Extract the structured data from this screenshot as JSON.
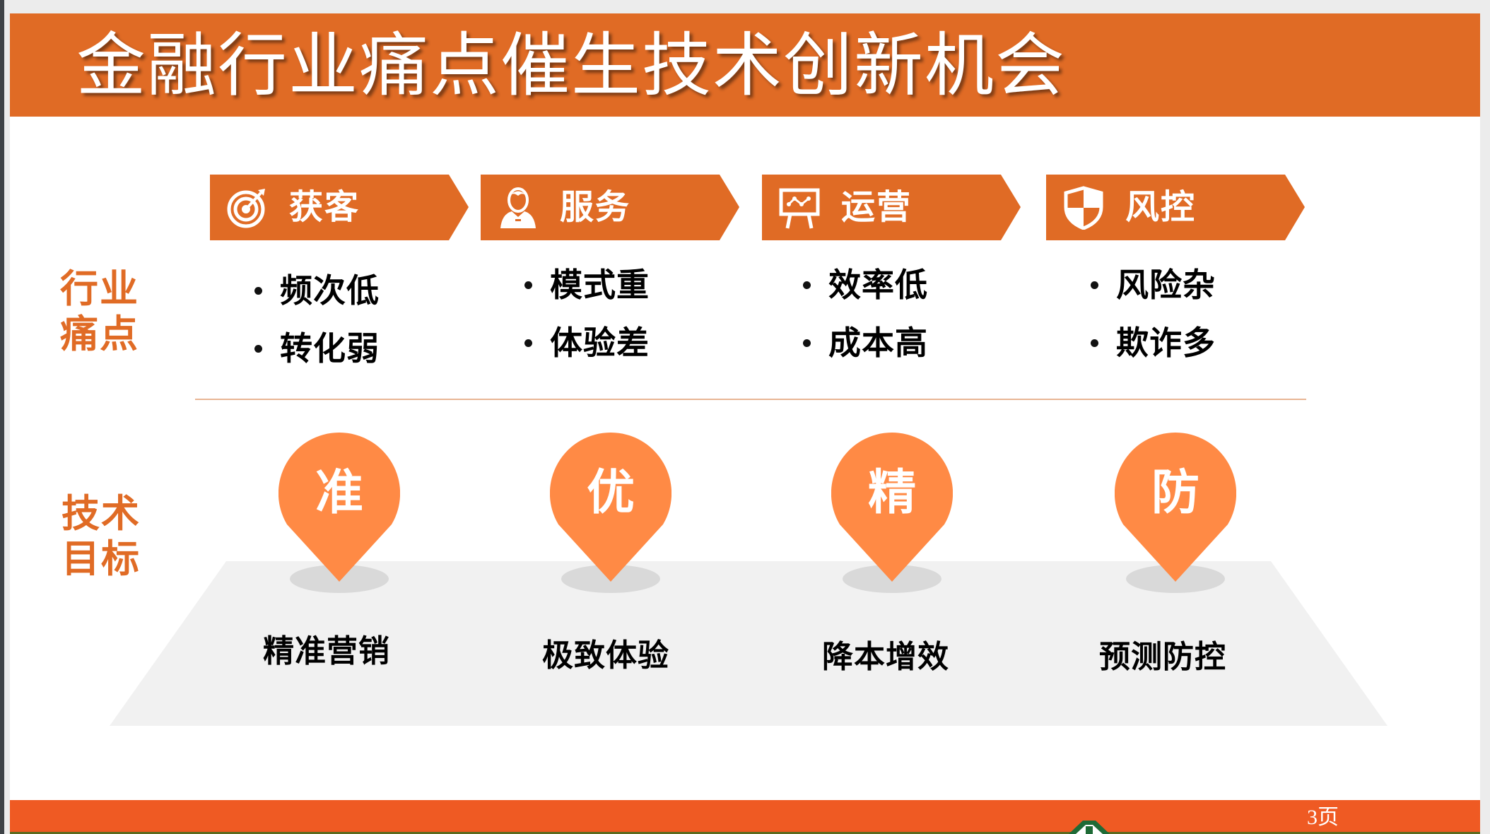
{
  "slide": {
    "title": "金融行业痛点催生技术创新机会",
    "page_number": "3页"
  },
  "colors": {
    "title_band": "#E06B25",
    "tab": "#E06B25",
    "row_label": "#E06B25",
    "pin": "#FF8A45",
    "platform": "#F1F1F1",
    "pin_shadow": "#D9D9D9",
    "footer": "#EF5A23",
    "divider": "#E8B594"
  },
  "row_labels": {
    "pain_points": [
      "行业",
      "痛点"
    ],
    "tech_goals": [
      "技术",
      "目标"
    ]
  },
  "categories": [
    {
      "label": "获客",
      "icon": "target-icon",
      "pain_points": [
        "频次低",
        "转化弱"
      ],
      "goal_char": "准",
      "goal_label": "精准营销"
    },
    {
      "label": "服务",
      "icon": "user-icon",
      "pain_points": [
        "模式重",
        "体验差"
      ],
      "goal_char": "优",
      "goal_label": "极致体验"
    },
    {
      "label": "运营",
      "icon": "presentation-chart-icon",
      "pain_points": [
        "效率低",
        "成本高"
      ],
      "goal_char": "精",
      "goal_label": "降本增效"
    },
    {
      "label": "风控",
      "icon": "shield-icon",
      "pain_points": [
        "风险杂",
        "欺诈多"
      ],
      "goal_char": "防",
      "goal_label": "预测防控"
    }
  ]
}
